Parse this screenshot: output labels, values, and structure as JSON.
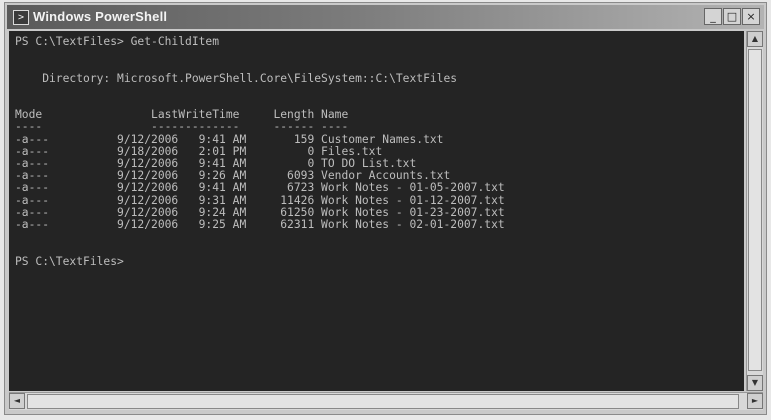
{
  "window": {
    "title": "Windows PowerShell",
    "icon": "powershell-icon",
    "buttons": {
      "minimize": "_",
      "maximize": "□",
      "close": "×"
    }
  },
  "console": {
    "lines": [
      "PS C:\\TextFiles> Get-ChildItem",
      "",
      "",
      "    Directory: Microsoft.PowerShell.Core\\FileSystem::C:\\TextFiles",
      "",
      "",
      "Mode                LastWriteTime     Length Name",
      "----                -------------     ------ ----",
      "-a---          9/12/2006   9:41 AM       159 Customer Names.txt",
      "-a---          9/18/2006   2:01 PM         0 Files.txt",
      "-a---          9/12/2006   9:41 AM         0 TO DO List.txt",
      "-a---          9/12/2006   9:26 AM      6093 Vendor Accounts.txt",
      "-a---          9/12/2006   9:41 AM      6723 Work Notes - 01-05-2007.txt",
      "-a---          9/12/2006   9:31 AM     11426 Work Notes - 01-12-2007.txt",
      "-a---          9/12/2006   9:24 AM     61250 Work Notes - 01-23-2007.txt",
      "-a---          9/12/2006   9:25 AM     62311 Work Notes - 02-01-2007.txt",
      "",
      "",
      "PS C:\\TextFiles>"
    ]
  },
  "scrollbars": {
    "up": "▲",
    "down": "▼",
    "left": "◄",
    "right": "►"
  }
}
